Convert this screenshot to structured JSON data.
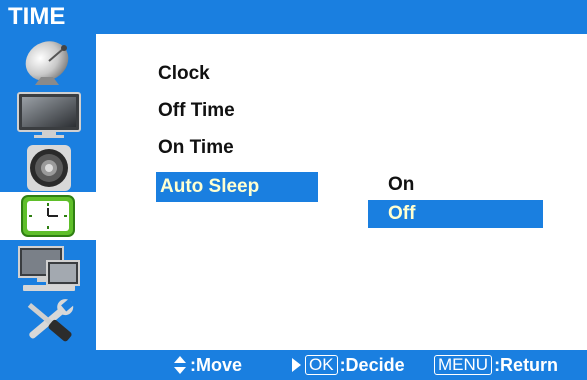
{
  "title": "TIME",
  "icons": [
    {
      "name": "satellite-dish-icon"
    },
    {
      "name": "tv-picture-icon"
    },
    {
      "name": "speaker-icon"
    },
    {
      "name": "clock-icon"
    },
    {
      "name": "pc-setup-icon"
    },
    {
      "name": "tools-icon"
    }
  ],
  "menu": {
    "items": [
      {
        "label": "Clock"
      },
      {
        "label": "Off Time"
      },
      {
        "label": "On Time"
      },
      {
        "label": "Auto Sleep"
      }
    ],
    "selected": "Auto Sleep"
  },
  "submenu": {
    "items": [
      {
        "label": "On"
      },
      {
        "label": "Off"
      }
    ],
    "selected": "Off"
  },
  "footer": {
    "move_label": ":Move",
    "ok_key": "OK",
    "decide_label": ":Decide",
    "menu_key": "MENU",
    "return_label": ":Return"
  },
  "colors": {
    "accent": "#1a7fe0",
    "highlight_text": "#ffffd0",
    "text": "#111111",
    "background": "#ffffff"
  }
}
